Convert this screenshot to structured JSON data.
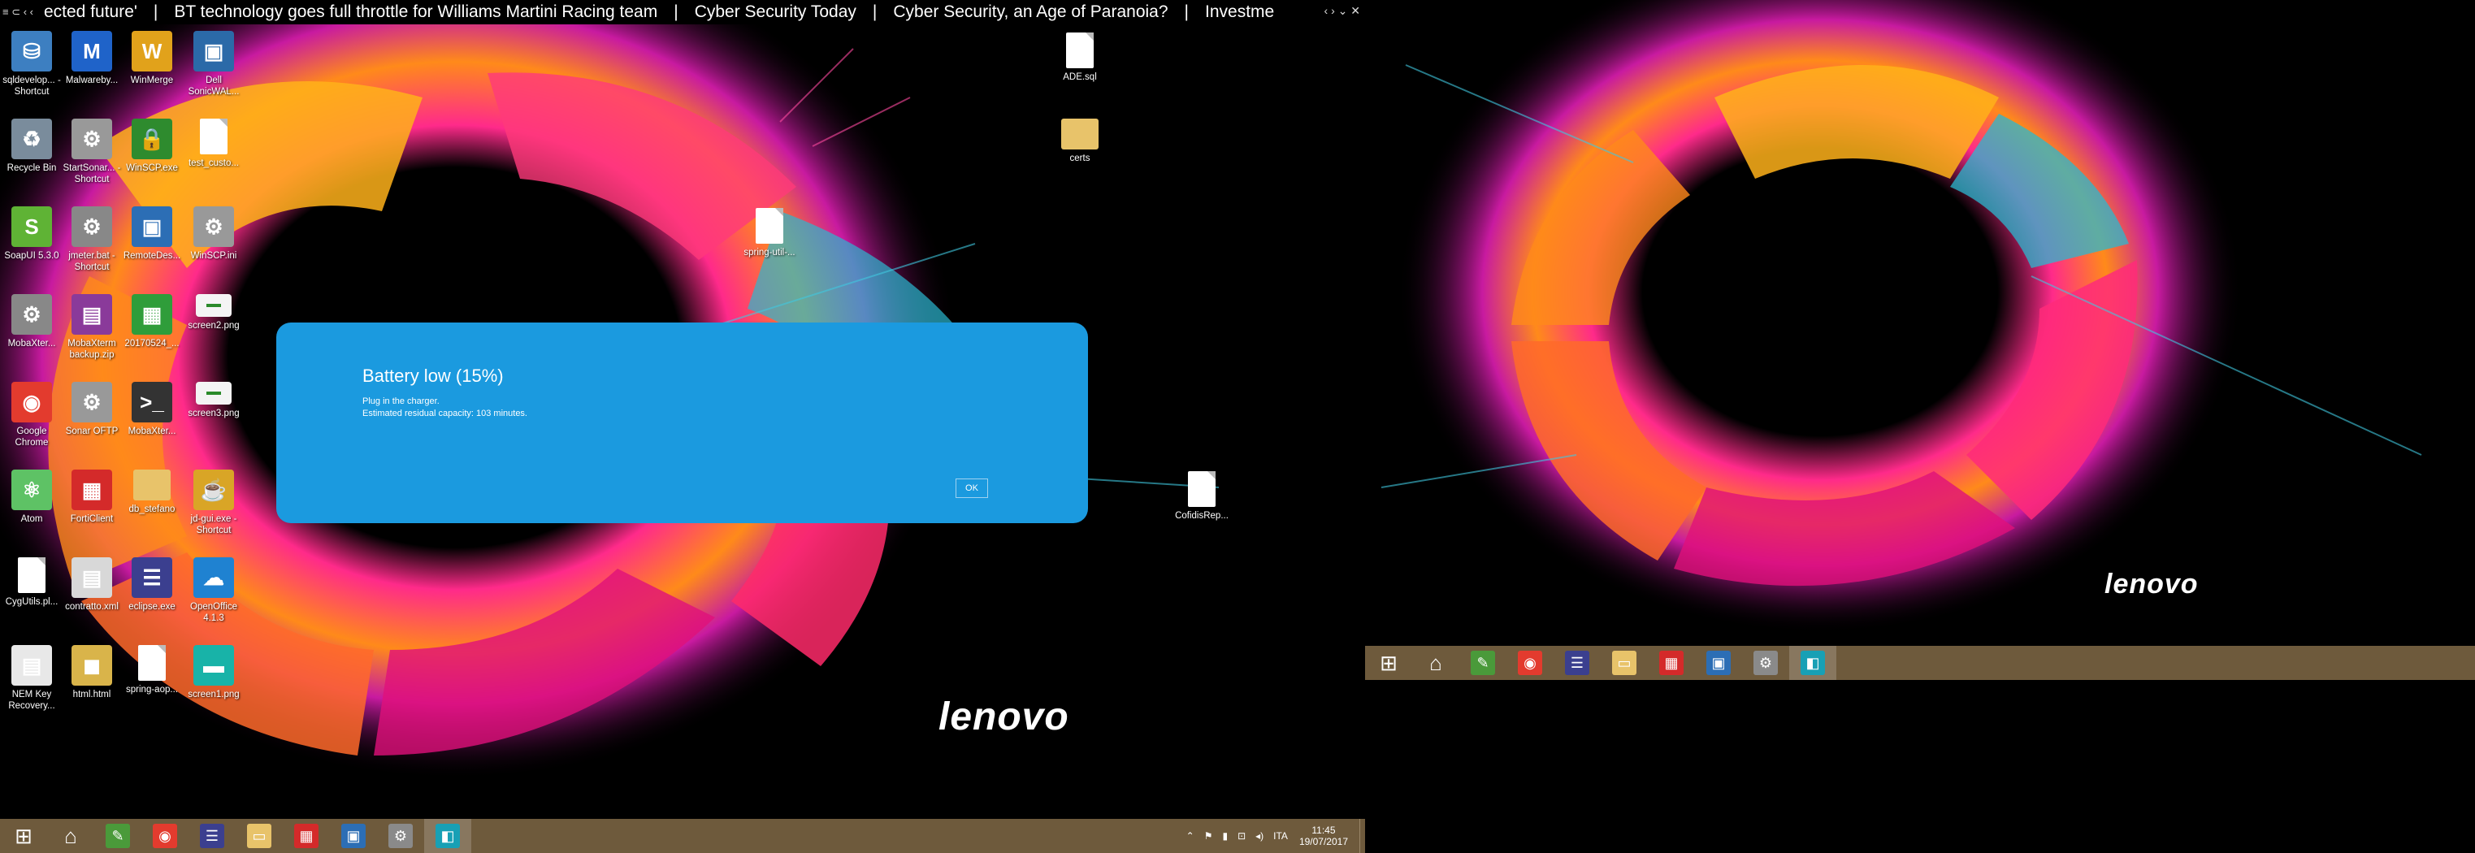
{
  "ticker": {
    "controls_left": "≡ ⊂ ‹ ‹",
    "items": [
      "ected future'",
      "BT technology goes full throttle for Williams Martini Racing team",
      "Cyber Security Today",
      "Cyber Security, an Age of Paranoia?",
      "Investme"
    ],
    "controls_right": "‹ › ⌄ ✕"
  },
  "desktop_icons": [
    {
      "label": "sqldevelop... - Shortcut",
      "icon": "sqldeveloper-icon",
      "color": "#3d7fc1",
      "glyph": "⛁"
    },
    {
      "label": "Malwareby...",
      "icon": "malwarebytes-icon",
      "color": "#1f63c9",
      "glyph": "M"
    },
    {
      "label": "WinMerge",
      "icon": "winmerge-icon",
      "color": "#e1a21b",
      "glyph": "W"
    },
    {
      "label": "Dell SonicWAL...",
      "icon": "sonicwall-icon",
      "color": "#2b6aa8",
      "glyph": "▣"
    },
    {
      "label": "Recycle Bin",
      "icon": "recycle-bin-icon",
      "color": "#7a8c9c",
      "glyph": "♻"
    },
    {
      "label": "StartSonar... - Shortcut",
      "icon": "startsonar-icon",
      "color": "#999",
      "glyph": "⚙"
    },
    {
      "label": "WinSCP.exe",
      "icon": "winscp-icon",
      "color": "#2e8b2e",
      "glyph": "🔒"
    },
    {
      "label": "test_custo...",
      "icon": "text-file-icon",
      "color": "doc",
      "glyph": ""
    },
    {
      "label": "SoapUI 5.3.0",
      "icon": "soapui-icon",
      "color": "#5fb335",
      "glyph": "S"
    },
    {
      "label": "jmeter.bat - Shortcut",
      "icon": "jmeter-icon",
      "color": "#888",
      "glyph": "⚙"
    },
    {
      "label": "RemoteDes...",
      "icon": "remote-desktop-icon",
      "color": "#2c6eb5",
      "glyph": "▣"
    },
    {
      "label": "WinSCP.ini",
      "icon": "ini-file-icon",
      "color": "#999",
      "glyph": "⚙"
    },
    {
      "label": "MobaXter...",
      "icon": "mobaxterm-gear-icon",
      "color": "#888",
      "glyph": "⚙"
    },
    {
      "label": "MobaXterm backup.zip",
      "icon": "zip-archive-icon",
      "color": "#8a3a9a",
      "glyph": "▤"
    },
    {
      "label": "20170524_...",
      "icon": "spreadsheet-icon",
      "color": "#2f9d3a",
      "glyph": "▦"
    },
    {
      "label": "screen2.png",
      "icon": "image-file-icon",
      "color": "shot",
      "glyph": ""
    },
    {
      "label": "Google Chrome",
      "icon": "chrome-icon",
      "color": "#e33b2e",
      "glyph": "◉"
    },
    {
      "label": "Sonar OFTP",
      "icon": "sonar-oftp-icon",
      "color": "#999",
      "glyph": "⚙"
    },
    {
      "label": "MobaXter...",
      "icon": "mobaxterm-icon",
      "color": "#333",
      "glyph": ">_"
    },
    {
      "label": "screen3.png",
      "icon": "image-file-icon",
      "color": "shot",
      "glyph": ""
    },
    {
      "label": "Atom",
      "icon": "atom-icon",
      "color": "#5ec265",
      "glyph": "⚛"
    },
    {
      "label": "FortiClient",
      "icon": "forticlient-icon",
      "color": "#d42a2a",
      "glyph": "▦"
    },
    {
      "label": "db_stefano",
      "icon": "folder-icon",
      "color": "folder",
      "glyph": ""
    },
    {
      "label": "jd-gui.exe - Shortcut",
      "icon": "jd-gui-icon",
      "color": "#d9a526",
      "glyph": "☕"
    },
    {
      "label": "CygUtils.pl...",
      "icon": "text-file-icon",
      "color": "doc",
      "glyph": ""
    },
    {
      "label": "contratto.xml",
      "icon": "xml-file-icon",
      "color": "#d8d8d8",
      "glyph": "▤"
    },
    {
      "label": "eclipse.exe",
      "icon": "eclipse-icon",
      "color": "#3b3f8f",
      "glyph": "☰"
    },
    {
      "label": "OpenOffice 4.1.3",
      "icon": "openoffice-icon",
      "color": "#1f82d1",
      "glyph": "☁"
    },
    {
      "label": "NEM Key Recovery...",
      "icon": "document-icon",
      "color": "#e8e8e8",
      "glyph": "▤"
    },
    {
      "label": "html.html",
      "icon": "html-file-icon",
      "color": "#d9b44a",
      "glyph": "◼"
    },
    {
      "label": "spring-aop...",
      "icon": "text-file-icon",
      "color": "doc",
      "glyph": ""
    },
    {
      "label": "screen1.png",
      "icon": "image-file-icon",
      "color": "#18b3a8",
      "glyph": "▬"
    }
  ],
  "desktop_right_icons": [
    {
      "label": "ADE.sql",
      "icon": "sql-file-icon"
    },
    {
      "label": "certs",
      "icon": "folder-icon"
    },
    {
      "label": "spring-util-...",
      "icon": "text-file-icon"
    },
    {
      "label": "CofidisRep...",
      "icon": "text-file-icon"
    }
  ],
  "dialog": {
    "title": "Battery low (15%)",
    "message_line1": "Plug in the charger.",
    "message_line2": "Estimated residual capacity: 103 minutes.",
    "ok_label": "OK",
    "background": "#1b9adf"
  },
  "brand": "lenovo",
  "taskbar_left": {
    "apps": [
      {
        "name": "start-icon",
        "glyph": "⊞",
        "color": "transparent"
      },
      {
        "name": "home-icon",
        "glyph": "⌂",
        "color": "transparent"
      },
      {
        "name": "notepad-icon",
        "glyph": "✎",
        "color": "#4a9a3a"
      },
      {
        "name": "chrome-icon",
        "glyph": "◉",
        "color": "#e33b2e"
      },
      {
        "name": "eclipse-icon",
        "glyph": "☰",
        "color": "#3b3f8f"
      },
      {
        "name": "file-explorer-icon",
        "glyph": "▭",
        "color": "#e8c36a"
      },
      {
        "name": "forticlient-icon",
        "glyph": "▦",
        "color": "#d42a2a"
      },
      {
        "name": "remote-desktop-icon",
        "glyph": "▣",
        "color": "#2c6eb5"
      },
      {
        "name": "settings-tool-icon",
        "glyph": "⚙",
        "color": "#8a8a8a"
      },
      {
        "name": "store-app-icon",
        "glyph": "◧",
        "color": "#18a0b5"
      }
    ],
    "tray": {
      "chevron": "⌃",
      "flag": "⚑",
      "battery": "▮",
      "network": "⊡",
      "volume": "◂)",
      "language": "ITA",
      "time": "11:45",
      "date": "19/07/2017"
    }
  },
  "taskbar_right": {
    "apps": [
      {
        "name": "start-icon",
        "glyph": "⊞",
        "color": "transparent"
      },
      {
        "name": "home-icon",
        "glyph": "⌂",
        "color": "transparent"
      },
      {
        "name": "notepad-icon",
        "glyph": "✎",
        "color": "#4a9a3a"
      },
      {
        "name": "chrome-icon",
        "glyph": "◉",
        "color": "#e33b2e"
      },
      {
        "name": "eclipse-icon",
        "glyph": "☰",
        "color": "#3b3f8f"
      },
      {
        "name": "file-explorer-icon",
        "glyph": "▭",
        "color": "#e8c36a"
      },
      {
        "name": "forticlient-icon",
        "glyph": "▦",
        "color": "#d42a2a"
      },
      {
        "name": "remote-desktop-icon",
        "glyph": "▣",
        "color": "#2c6eb5"
      },
      {
        "name": "settings-tool-icon",
        "glyph": "⚙",
        "color": "#8a8a8a"
      },
      {
        "name": "store-app-icon",
        "glyph": "◧",
        "color": "#18a0b5"
      }
    ]
  }
}
